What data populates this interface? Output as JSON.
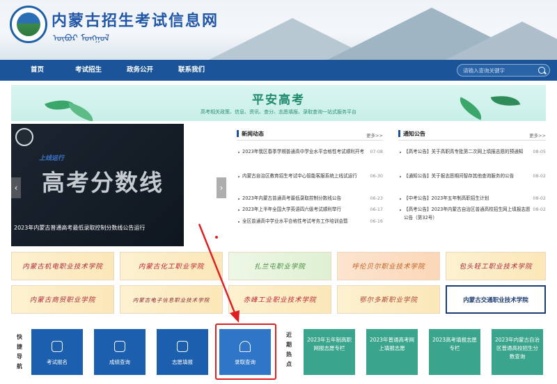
{
  "site": {
    "title": "内蒙古招生考试信息网",
    "mongol": "ᠥᠪᠥᠷ ᠮᠣᠩᠭᠣᠯ"
  },
  "nav": {
    "items": [
      "首页",
      "考试招生",
      "政务公开",
      "联系我们"
    ],
    "search_placeholder": "请输入查询关键字"
  },
  "banner": {
    "title": "平安高考",
    "subtitle": "高考相关政策、信息、资讯、查分、志愿填报、录取查询一站式服务平台"
  },
  "slider": {
    "tag": "上线运行",
    "big_text": "高考分数线",
    "caption": "2023年内蒙古普通高考最低录取控制分数线公告运行"
  },
  "news": {
    "title": "新闻动态",
    "more": "更多>>",
    "items": [
      {
        "text": "2023年我区春季学期普通高中学业水平合格性考试顺利开考",
        "date": "07-08"
      },
      {
        "text": "内蒙古自治区教育招生考试中心智能客服系统上线试运行",
        "date": "06-30"
      },
      {
        "text": "2023年内蒙古普通高考最低录取控制分数线公告",
        "date": "06-23"
      },
      {
        "text": "2023年上半年全国大学英语四六级考试顺利举行",
        "date": "06-17"
      },
      {
        "text": "全区普通高中学业水平合格性考试考务工作培训会暨",
        "date": "06-16"
      }
    ]
  },
  "notices": {
    "title": "通知公告",
    "more": "更多>>",
    "items": [
      {
        "text": "【高考公告】关于高职高专批第二次网上填报志愿的预通知",
        "date": "08-05"
      },
      {
        "text": "【通知公告】关于报志愿期间智存其他查询服务的公告",
        "date": "08-02"
      },
      {
        "text": "【中考公告】2023年五年制高职招生计划",
        "date": "08-02"
      },
      {
        "text": "【高考公告】2023年内蒙古自治区普通高校招生网上填报志愿公告（第32号）",
        "date": "08-02"
      }
    ]
  },
  "schools": [
    "内蒙古机电职业技术学院",
    "内蒙古化工职业学院",
    "扎兰屯职业学院",
    "呼伦贝尔职业技术学院",
    "包头轻工职业技术学院",
    "内蒙古商贸职业学院",
    "内蒙古电子信息职业技术学院",
    "赤峰工业职业技术学院",
    "鄂尔多斯职业学院",
    "内蒙古交通职业技术学院"
  ],
  "quick": {
    "label": "快捷导航",
    "buttons": [
      "考试报名",
      "成绩查询",
      "志愿填报",
      "录取查询"
    ]
  },
  "hot": {
    "label": "近期热点",
    "buttons": [
      "2023年五年制高职网报志愿专栏",
      "2023年普通高考网上填报志愿",
      "2023高考填报志愿专栏",
      "2023年内蒙古自治区普通高校招生分数查询"
    ]
  },
  "colors": {
    "nav": "#1b5499",
    "quick": "#1b5fae",
    "hot": "#3aa58c",
    "highlight": "#e02020"
  }
}
